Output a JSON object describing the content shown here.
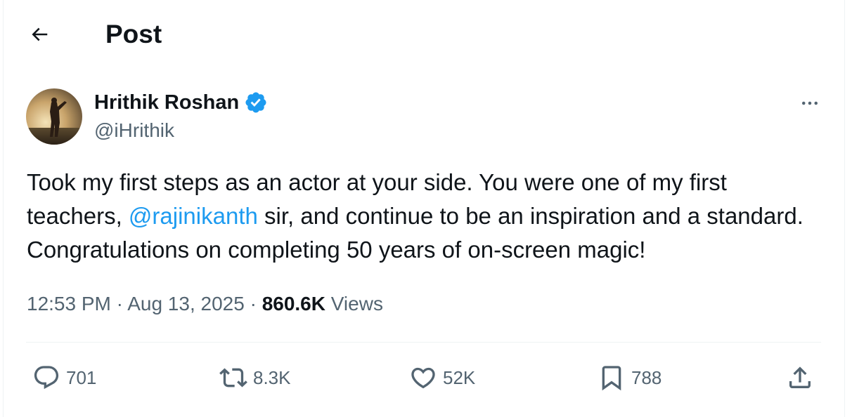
{
  "header": {
    "title": "Post",
    "back_icon": "arrow-left-icon"
  },
  "author": {
    "name": "Hrithik Roshan",
    "handle": "@iHrithik",
    "verified_icon": "verified-badge-icon",
    "verified_color": "#1d9bf0"
  },
  "tweet": {
    "text_part1": "Took my first steps as an actor at your side. You were one of my first teachers, ",
    "mention": "@rajinikanth",
    "text_part2": " sir, and continue to be an inspiration and a standard. Congratulations on completing 50 years of on-screen magic!"
  },
  "meta": {
    "time": "12:53 PM",
    "separator": "·",
    "date": "Aug 13, 2025",
    "views_count": "860.6K",
    "views_label": "Views"
  },
  "actions": {
    "replies": "701",
    "reposts": "8.3K",
    "likes": "52K",
    "bookmarks": "788"
  },
  "colors": {
    "accent": "#1d9bf0",
    "text": "#0f1419",
    "secondary": "#536471"
  }
}
